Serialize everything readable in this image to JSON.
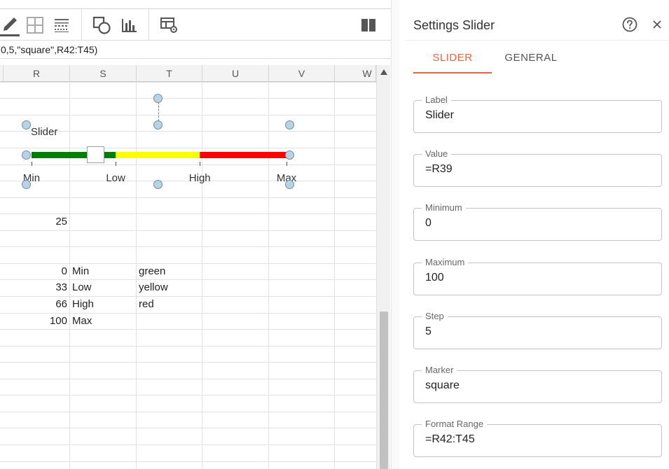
{
  "formula_bar": {
    "text": "0,5,\"square\",R42:T45)"
  },
  "toolbar": {
    "icons": [
      "pencil-icon",
      "grid-icon",
      "borders-icon",
      "shapes-icon",
      "bar-chart-icon",
      "table-settings-icon",
      "panel-toggle-icon"
    ]
  },
  "grid": {
    "columns": [
      "R",
      "S",
      "T",
      "U",
      "V",
      "W"
    ],
    "cells": {
      "r25": "25",
      "r_min_val": "0",
      "r_min_lbl": "Min",
      "r_min_col": "green",
      "r_low_val": "33",
      "r_low_lbl": "Low",
      "r_low_col": "yellow",
      "r_high_val": "66",
      "r_high_lbl": "High",
      "r_high_col": "red",
      "r_max_val": "100",
      "r_max_lbl": "Max"
    }
  },
  "slider": {
    "title": "Slider",
    "value": 25,
    "min": 0,
    "max": 100,
    "ticks": [
      "Min",
      "Low",
      "High",
      "Max"
    ],
    "colors": {
      "green": "#008000",
      "yellow": "#ffff00",
      "red": "#ff0000"
    }
  },
  "panel": {
    "title": "Settings Slider",
    "tabs": [
      "SLIDER",
      "GENERAL"
    ],
    "active_tab": "SLIDER",
    "accent": "#e8623c",
    "fields": {
      "label": {
        "label": "Label",
        "value": "Slider"
      },
      "value": {
        "label": "Value",
        "value": "=R39"
      },
      "minimum": {
        "label": "Minimum",
        "value": "0"
      },
      "maximum": {
        "label": "Maximum",
        "value": "100"
      },
      "step": {
        "label": "Step",
        "value": "5"
      },
      "marker": {
        "label": "Marker",
        "value": "square"
      },
      "format_range": {
        "label": "Format Range",
        "value": "=R42:T45"
      }
    }
  }
}
